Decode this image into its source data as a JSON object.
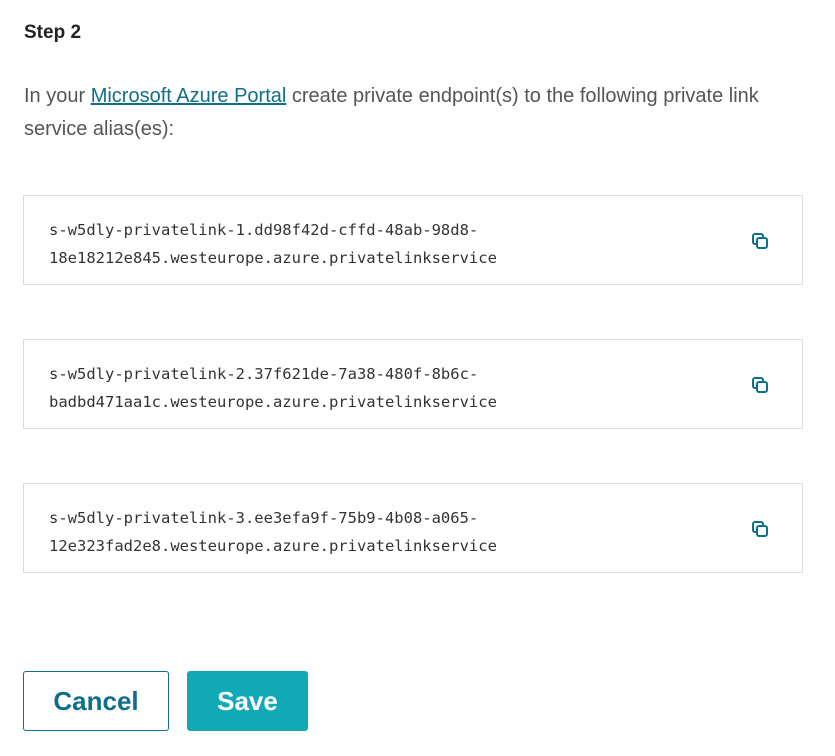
{
  "step": {
    "title": "Step 2"
  },
  "instructions": {
    "prefix": "In your ",
    "link_text": "Microsoft Azure Portal",
    "suffix": " create private endpoint(s) to the following private link service alias(es):"
  },
  "aliases": [
    {
      "line1": "s-w5dly-privatelink-1.dd98f42d-cffd-48ab-98d8-",
      "line2": "18e18212e845.westeurope.azure.privatelinkservice"
    },
    {
      "line1": "s-w5dly-privatelink-2.37f621de-7a38-480f-8b6c-",
      "line2": "badbd471aa1c.westeurope.azure.privatelinkservice"
    },
    {
      "line1": "s-w5dly-privatelink-3.ee3efa9f-75b9-4b08-a065-",
      "line2": "12e323fad2e8.westeurope.azure.privatelinkservice"
    }
  ],
  "icons": {
    "copy": "copy-icon"
  },
  "buttons": {
    "cancel_label": "Cancel",
    "save_label": "Save"
  },
  "colors": {
    "accent": "#12a9b6",
    "link": "#0f6f8a",
    "border": "#dcdcdc"
  }
}
